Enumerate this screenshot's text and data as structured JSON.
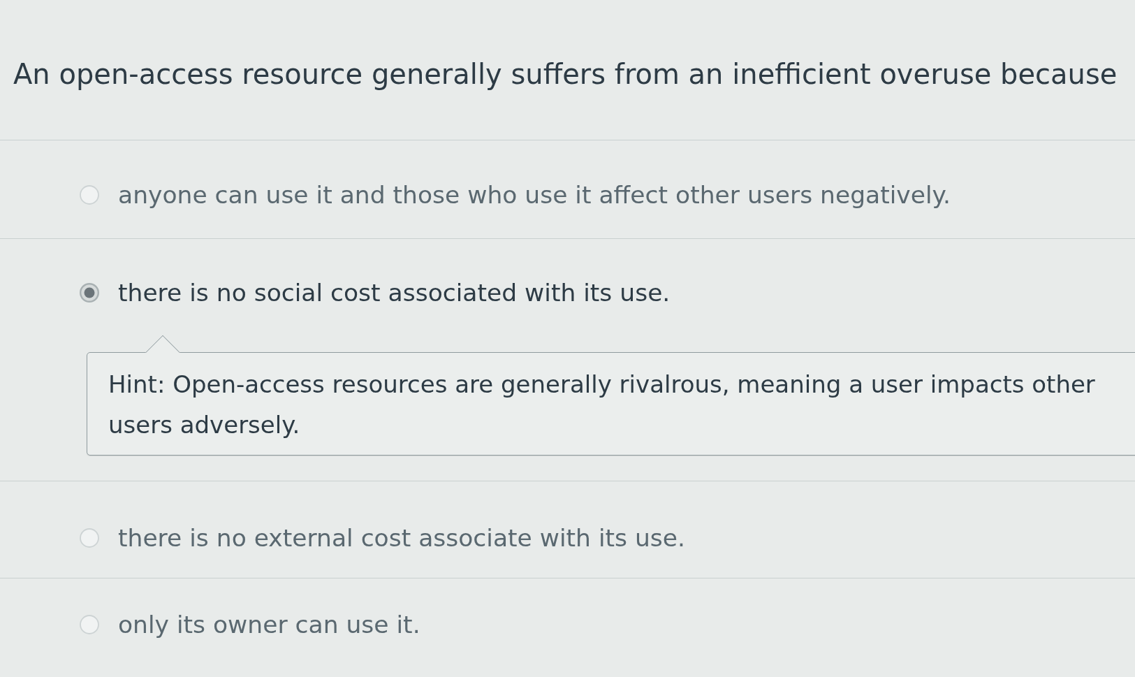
{
  "question": {
    "text": "An open-access resource generally suffers from an inefficient overuse because"
  },
  "options": [
    {
      "label": "anyone can use it and those who use it affect other users negatively.",
      "selected": false
    },
    {
      "label": "there is no social cost associated with its use.",
      "selected": true,
      "hint": "Hint: Open-access resources are generally rivalrous, meaning a user impacts other users adversely."
    },
    {
      "label": "there is no external cost associate with its use.",
      "selected": false
    },
    {
      "label": "only its owner can use it.",
      "selected": false
    }
  ]
}
